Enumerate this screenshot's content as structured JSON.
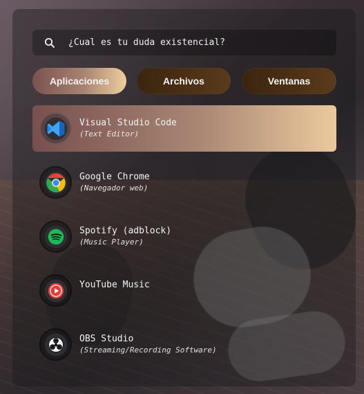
{
  "colors": {
    "accent_gradient_start": "#7b5150",
    "accent_gradient_mid": "#a88472",
    "accent_gradient_end": "#f0cd9f",
    "tab_inactive_start": "#3b240f",
    "tab_inactive_end": "#5a3a1b",
    "panel_bg": "rgba(24,24,28,0.40)",
    "text": "#f4f4f4"
  },
  "search": {
    "placeholder": "¿Cual es tu duda existencial?",
    "icon": "search-icon"
  },
  "tabs": [
    {
      "label": "Aplicaciones",
      "active": true
    },
    {
      "label": "Archivos",
      "active": false
    },
    {
      "label": "Ventanas",
      "active": false
    }
  ],
  "apps": [
    {
      "name": "Visual Studio Code",
      "description": "(Text Editor)",
      "icon": "vscode-icon",
      "selected": true
    },
    {
      "name": "Google Chrome",
      "description": "(Navegador web)",
      "icon": "chrome-icon",
      "selected": false
    },
    {
      "name": "Spotify (adblock)",
      "description": "(Music Player)",
      "icon": "spotify-icon",
      "selected": false
    },
    {
      "name": "YouTube Music",
      "description": "",
      "icon": "youtube-music-icon",
      "selected": false
    },
    {
      "name": "OBS Studio",
      "description": "(Streaming/Recording Software)",
      "icon": "obs-icon",
      "selected": false
    }
  ]
}
